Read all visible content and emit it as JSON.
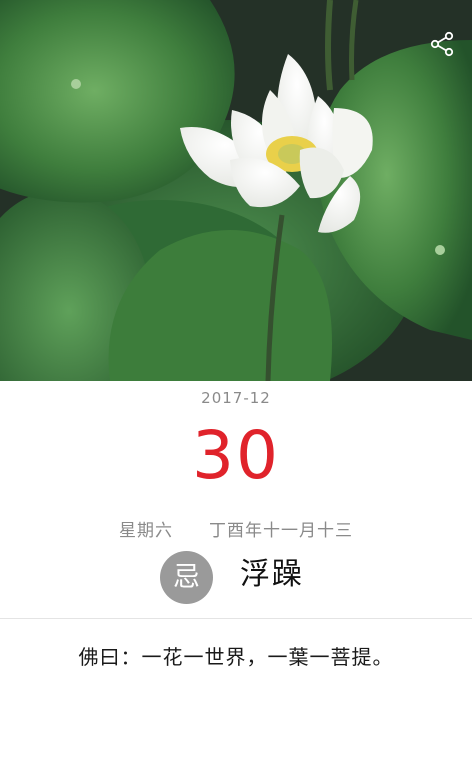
{
  "colors": {
    "accent_red": "#e0232b",
    "muted_gray": "#8a8a8a",
    "badge_gray": "#9a9a9a"
  },
  "header": {
    "share_icon": "share-icon"
  },
  "date": {
    "year_month": "2017-12",
    "day": "30",
    "weekday": "星期六",
    "lunar": "丁酉年十一月十三"
  },
  "avoid": {
    "badge": "忌",
    "text": "浮躁"
  },
  "quote": {
    "text": "佛曰：一花一世界，一葉一菩提。"
  }
}
